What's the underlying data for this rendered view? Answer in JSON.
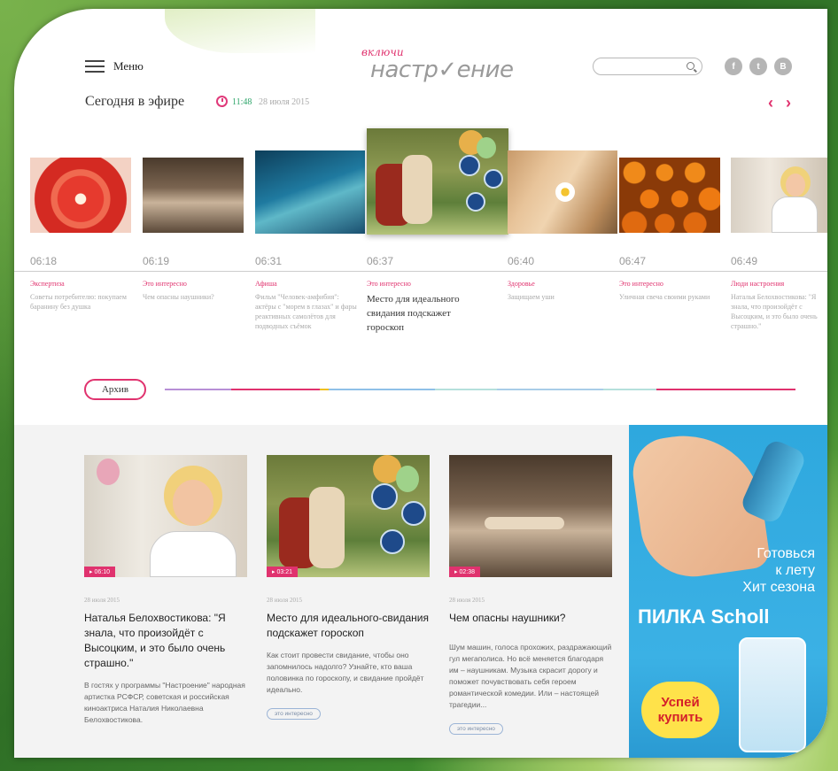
{
  "header": {
    "menu_label": "Меню",
    "logo_small": "включи",
    "logo_big": "настр✓ение",
    "search_placeholder": "",
    "social": [
      "f",
      "t",
      "B"
    ]
  },
  "on_air": {
    "title": "Сегодня в эфире",
    "time": "11:48",
    "date": "28 июля 2015"
  },
  "schedule": [
    {
      "time": "06:18",
      "category": "Экспертиза",
      "desc": "Советы потребителю: покупаем баранину без душка"
    },
    {
      "time": "06:19",
      "category": "Это интересно",
      "desc": "Чем опасны наушники?"
    },
    {
      "time": "06:31",
      "category": "Афиша",
      "desc": "Фильм \"Человек-амфибия\": актёры с \"морем в глазах\" и фары реактивных самолётов для подводных съёмок"
    },
    {
      "time": "06:37",
      "category": "Это интересно",
      "desc": "Место для идеального свидания подскажет гороскоп"
    },
    {
      "time": "06:40",
      "category": "Здоровье",
      "desc": "Защищаем уши"
    },
    {
      "time": "06:47",
      "category": "Это интересно",
      "desc": "Уличная свеча своими руками"
    },
    {
      "time": "06:49",
      "category": "Люди настроения",
      "desc": "Наталья Белохвостикова: \"Я знала, что произойдёт с Высоцким, и это было очень страшно.\""
    }
  ],
  "archive_label": "Архив",
  "articles": [
    {
      "duration": "06:10",
      "date": "28 июля 2015",
      "title": "Наталья Белохвостикова: \"Я знала, что произойдёт с Высоцким, и это было очень страшно.\"",
      "text": "В гостях у программы \"Настроение\" народная артистка РСФСР, советская и российская киноактриса Наталия Николаевна Белохвостикова.",
      "tag": ""
    },
    {
      "duration": "03:21",
      "date": "28 июля 2015",
      "title": "Место для идеального-свидания подскажет гороскоп",
      "text": "Как стоит провести свидание, чтобы оно запомнилось надолго? Узнайте, кто ваша половинка по гороскопу, и свидание пройдёт идеально.",
      "tag": "это интересно"
    },
    {
      "duration": "02:38",
      "date": "28 июля 2015",
      "title": "Чем опасны наушники?",
      "text": "Шум машин, голоса прохожих, раздражающий гул мегаполиса. Но всё меняется благодаря им – наушникам. Музыка скрасит дорогу и поможет почувствовать себя героем романтической комедии. Или – настоящей трагедии...",
      "tag": "это интересно"
    }
  ],
  "ad": {
    "line1": "Готовься",
    "line2": "к лету",
    "line3": "Хит сезона",
    "brand": "ПИЛКА Scholl",
    "cta1": "Успей",
    "cta2": "купить"
  },
  "colors": {
    "accent": "#e0326e",
    "green": "#2ea56a",
    "ad_blue": "#2ea8de"
  }
}
